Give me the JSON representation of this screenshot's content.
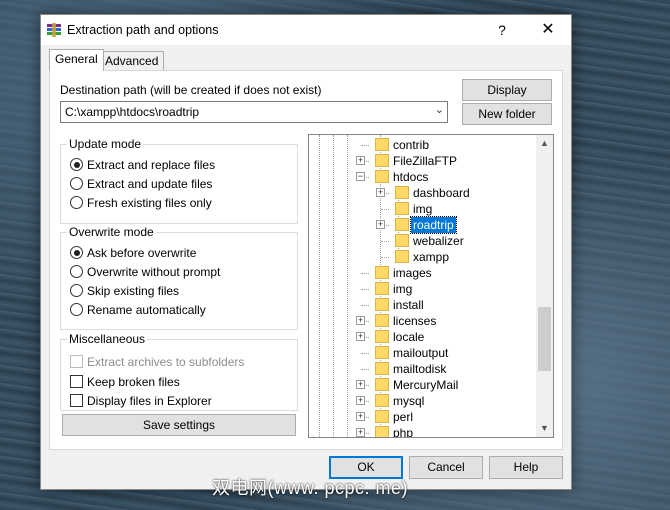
{
  "window": {
    "title": "Extraction path and options",
    "help_glyph": "?",
    "close_glyph": "✕"
  },
  "tabs": [
    {
      "label": "General",
      "active": true
    },
    {
      "label": "Advanced",
      "active": false
    }
  ],
  "destination": {
    "label": "Destination path (will be created if does not exist)",
    "value": "C:\\xampp\\htdocs\\roadtrip"
  },
  "buttons": {
    "display": "Display",
    "new_folder": "New folder",
    "save_settings": "Save settings",
    "ok": "OK",
    "cancel": "Cancel",
    "help": "Help"
  },
  "update_mode": {
    "title": "Update mode",
    "options": [
      {
        "label": "Extract and replace files",
        "selected": true
      },
      {
        "label": "Extract and update files",
        "selected": false
      },
      {
        "label": "Fresh existing files only",
        "selected": false
      }
    ]
  },
  "overwrite_mode": {
    "title": "Overwrite mode",
    "options": [
      {
        "label": "Ask before overwrite",
        "selected": true
      },
      {
        "label": "Overwrite without prompt",
        "selected": false
      },
      {
        "label": "Skip existing files",
        "selected": false
      },
      {
        "label": "Rename automatically",
        "selected": false
      }
    ]
  },
  "miscellaneous": {
    "title": "Miscellaneous",
    "options": [
      {
        "label": "Extract archives to subfolders",
        "checked": false,
        "disabled": true
      },
      {
        "label": "Keep broken files",
        "checked": false,
        "disabled": false
      },
      {
        "label": "Display files in Explorer",
        "checked": false,
        "disabled": false
      }
    ]
  },
  "tree": {
    "items": [
      {
        "label": "contrib",
        "expander": "",
        "selected": false
      },
      {
        "label": "FileZillaFTP",
        "expander": "+",
        "selected": false
      },
      {
        "label": "htdocs",
        "expander": "−",
        "selected": false
      },
      {
        "label": "dashboard",
        "expander": "+",
        "selected": false
      },
      {
        "label": "img",
        "expander": "",
        "selected": false
      },
      {
        "label": "roadtrip",
        "expander": "+",
        "selected": true
      },
      {
        "label": "webalizer",
        "expander": "",
        "selected": false
      },
      {
        "label": "xampp",
        "expander": "",
        "selected": false
      },
      {
        "label": "images",
        "expander": "",
        "selected": false
      },
      {
        "label": "img",
        "expander": "",
        "selected": false
      },
      {
        "label": "install",
        "expander": "",
        "selected": false
      },
      {
        "label": "licenses",
        "expander": "+",
        "selected": false
      },
      {
        "label": "locale",
        "expander": "+",
        "selected": false
      },
      {
        "label": "mailoutput",
        "expander": "",
        "selected": false
      },
      {
        "label": "mailtodisk",
        "expander": "",
        "selected": false
      },
      {
        "label": "MercuryMail",
        "expander": "+",
        "selected": false
      },
      {
        "label": "mysql",
        "expander": "+",
        "selected": false
      },
      {
        "label": "perl",
        "expander": "+",
        "selected": false
      },
      {
        "label": "php",
        "expander": "+",
        "selected": false
      }
    ],
    "scroll_up_glyph": "▲",
    "scroll_down_glyph": "▼"
  },
  "watermark": "双电网(www. pcpc. me)",
  "icons": {
    "app": "winrar-books-icon",
    "folder": "folder-icon"
  },
  "colors": {
    "selection": "#0078d7",
    "folder": "#ffd968"
  }
}
